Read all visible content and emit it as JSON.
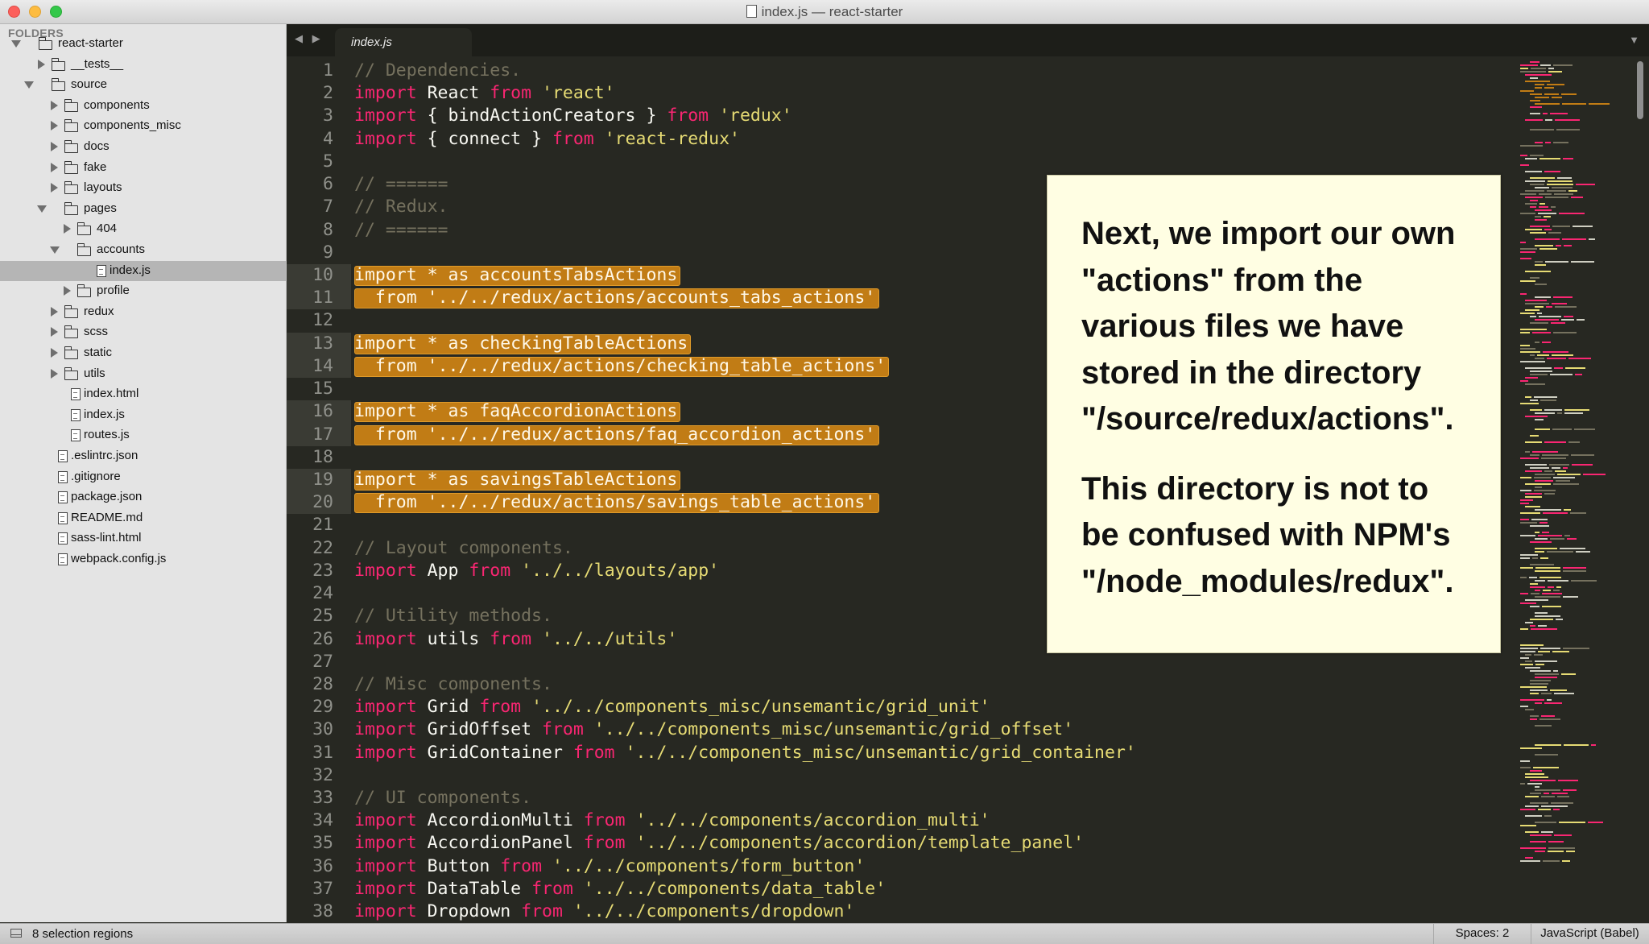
{
  "window": {
    "title": "index.js — react-starter"
  },
  "sidebar": {
    "header": "FOLDERS",
    "tree": [
      {
        "label": "react-starter",
        "type": "folder",
        "depth": 0,
        "open": true
      },
      {
        "label": "__tests__",
        "type": "folder",
        "depth": 1,
        "open": false
      },
      {
        "label": "source",
        "type": "folder",
        "depth": 1,
        "open": true
      },
      {
        "label": "components",
        "type": "folder",
        "depth": 2,
        "open": false
      },
      {
        "label": "components_misc",
        "type": "folder",
        "depth": 2,
        "open": false
      },
      {
        "label": "docs",
        "type": "folder",
        "depth": 2,
        "open": false
      },
      {
        "label": "fake",
        "type": "folder",
        "depth": 2,
        "open": false
      },
      {
        "label": "layouts",
        "type": "folder",
        "depth": 2,
        "open": false
      },
      {
        "label": "pages",
        "type": "folder",
        "depth": 2,
        "open": true
      },
      {
        "label": "404",
        "type": "folder",
        "depth": 3,
        "open": false
      },
      {
        "label": "accounts",
        "type": "folder",
        "depth": 3,
        "open": true
      },
      {
        "label": "index.js",
        "type": "file",
        "depth": 4,
        "selected": true
      },
      {
        "label": "profile",
        "type": "folder",
        "depth": 3,
        "open": false
      },
      {
        "label": "redux",
        "type": "folder",
        "depth": 2,
        "open": false
      },
      {
        "label": "scss",
        "type": "folder",
        "depth": 2,
        "open": false
      },
      {
        "label": "static",
        "type": "folder",
        "depth": 2,
        "open": false
      },
      {
        "label": "utils",
        "type": "folder",
        "depth": 2,
        "open": false
      },
      {
        "label": "index.html",
        "type": "file",
        "depth": 2
      },
      {
        "label": "index.js",
        "type": "file",
        "depth": 2
      },
      {
        "label": "routes.js",
        "type": "file",
        "depth": 2
      },
      {
        "label": ".eslintrc.json",
        "type": "file",
        "depth": 1
      },
      {
        "label": ".gitignore",
        "type": "file",
        "depth": 1
      },
      {
        "label": "package.json",
        "type": "file",
        "depth": 1
      },
      {
        "label": "README.md",
        "type": "file",
        "depth": 1
      },
      {
        "label": "sass-lint.html",
        "type": "file",
        "depth": 1
      },
      {
        "label": "webpack.config.js",
        "type": "file",
        "depth": 1
      }
    ]
  },
  "tabs": {
    "nav": "◀ ▶",
    "active": "index.js",
    "menu_icon": "▼"
  },
  "editor": {
    "lines": [
      {
        "n": 1,
        "tokens": [
          [
            "cm",
            "// Dependencies."
          ]
        ]
      },
      {
        "n": 2,
        "tokens": [
          [
            "kw",
            "import"
          ],
          [
            "",
            " React "
          ],
          [
            "kw",
            "from"
          ],
          [
            "",
            " "
          ],
          [
            "st",
            "'react'"
          ]
        ]
      },
      {
        "n": 3,
        "tokens": [
          [
            "kw",
            "import"
          ],
          [
            "",
            " { bindActionCreators } "
          ],
          [
            "kw",
            "from"
          ],
          [
            "",
            " "
          ],
          [
            "st",
            "'redux'"
          ]
        ]
      },
      {
        "n": 4,
        "tokens": [
          [
            "kw",
            "import"
          ],
          [
            "",
            " { connect } "
          ],
          [
            "kw",
            "from"
          ],
          [
            "",
            " "
          ],
          [
            "st",
            "'react-redux'"
          ]
        ]
      },
      {
        "n": 5,
        "tokens": []
      },
      {
        "n": 6,
        "tokens": [
          [
            "cm",
            "// ======"
          ]
        ]
      },
      {
        "n": 7,
        "tokens": [
          [
            "cm",
            "// Redux."
          ]
        ]
      },
      {
        "n": 8,
        "tokens": [
          [
            "cm",
            "// ======"
          ]
        ]
      },
      {
        "n": 9,
        "tokens": []
      },
      {
        "n": 10,
        "sel": true,
        "tokens": [
          [
            "kw",
            "import"
          ],
          [
            "",
            " * as accountsTabsActions"
          ]
        ]
      },
      {
        "n": 11,
        "sel": true,
        "tokens": [
          [
            "",
            "  "
          ],
          [
            "kw",
            "from"
          ],
          [
            "",
            " "
          ],
          [
            "st",
            "'../../redux/actions/accounts_tabs_actions'"
          ]
        ]
      },
      {
        "n": 12,
        "tokens": []
      },
      {
        "n": 13,
        "sel": true,
        "tokens": [
          [
            "kw",
            "import"
          ],
          [
            "",
            " * as checkingTableActions"
          ]
        ]
      },
      {
        "n": 14,
        "sel": true,
        "tokens": [
          [
            "",
            "  "
          ],
          [
            "kw",
            "from"
          ],
          [
            "",
            " "
          ],
          [
            "st",
            "'../../redux/actions/checking_table_actions'"
          ]
        ]
      },
      {
        "n": 15,
        "tokens": []
      },
      {
        "n": 16,
        "sel": true,
        "tokens": [
          [
            "kw",
            "import"
          ],
          [
            "",
            " * as faqAccordionActions"
          ]
        ]
      },
      {
        "n": 17,
        "sel": true,
        "tokens": [
          [
            "",
            "  "
          ],
          [
            "kw",
            "from"
          ],
          [
            "",
            " "
          ],
          [
            "st",
            "'../../redux/actions/faq_accordion_actions'"
          ]
        ]
      },
      {
        "n": 18,
        "tokens": []
      },
      {
        "n": 19,
        "sel": true,
        "tokens": [
          [
            "kw",
            "import"
          ],
          [
            "",
            " * as savingsTableActions"
          ]
        ]
      },
      {
        "n": 20,
        "sel": true,
        "tokens": [
          [
            "",
            "  "
          ],
          [
            "kw",
            "from"
          ],
          [
            "",
            " "
          ],
          [
            "st",
            "'../../redux/actions/savings_table_actions'"
          ]
        ]
      },
      {
        "n": 21,
        "tokens": []
      },
      {
        "n": 22,
        "tokens": [
          [
            "cm",
            "// Layout components."
          ]
        ]
      },
      {
        "n": 23,
        "tokens": [
          [
            "kw",
            "import"
          ],
          [
            "",
            " App "
          ],
          [
            "kw",
            "from"
          ],
          [
            "",
            " "
          ],
          [
            "st",
            "'../../layouts/app'"
          ]
        ]
      },
      {
        "n": 24,
        "tokens": []
      },
      {
        "n": 25,
        "tokens": [
          [
            "cm",
            "// Utility methods."
          ]
        ]
      },
      {
        "n": 26,
        "tokens": [
          [
            "kw",
            "import"
          ],
          [
            "",
            " utils "
          ],
          [
            "kw",
            "from"
          ],
          [
            "",
            " "
          ],
          [
            "st",
            "'../../utils'"
          ]
        ]
      },
      {
        "n": 27,
        "tokens": []
      },
      {
        "n": 28,
        "tokens": [
          [
            "cm",
            "// Misc components."
          ]
        ]
      },
      {
        "n": 29,
        "tokens": [
          [
            "kw",
            "import"
          ],
          [
            "",
            " Grid "
          ],
          [
            "kw",
            "from"
          ],
          [
            "",
            " "
          ],
          [
            "st",
            "'../../components_misc/unsemantic/grid_unit'"
          ]
        ]
      },
      {
        "n": 30,
        "tokens": [
          [
            "kw",
            "import"
          ],
          [
            "",
            " GridOffset "
          ],
          [
            "kw",
            "from"
          ],
          [
            "",
            " "
          ],
          [
            "st",
            "'../../components_misc/unsemantic/grid_offset'"
          ]
        ]
      },
      {
        "n": 31,
        "tokens": [
          [
            "kw",
            "import"
          ],
          [
            "",
            " GridContainer "
          ],
          [
            "kw",
            "from"
          ],
          [
            "",
            " "
          ],
          [
            "st",
            "'../../components_misc/unsemantic/grid_container'"
          ]
        ]
      },
      {
        "n": 32,
        "tokens": []
      },
      {
        "n": 33,
        "tokens": [
          [
            "cm",
            "// UI components."
          ]
        ]
      },
      {
        "n": 34,
        "tokens": [
          [
            "kw",
            "import"
          ],
          [
            "",
            " AccordionMulti "
          ],
          [
            "kw",
            "from"
          ],
          [
            "",
            " "
          ],
          [
            "st",
            "'../../components/accordion_multi'"
          ]
        ]
      },
      {
        "n": 35,
        "tokens": [
          [
            "kw",
            "import"
          ],
          [
            "",
            " AccordionPanel "
          ],
          [
            "kw",
            "from"
          ],
          [
            "",
            " "
          ],
          [
            "st",
            "'../../components/accordion/template_panel'"
          ]
        ]
      },
      {
        "n": 36,
        "tokens": [
          [
            "kw",
            "import"
          ],
          [
            "",
            " Button "
          ],
          [
            "kw",
            "from"
          ],
          [
            "",
            " "
          ],
          [
            "st",
            "'../../components/form_button'"
          ]
        ]
      },
      {
        "n": 37,
        "tokens": [
          [
            "kw",
            "import"
          ],
          [
            "",
            " DataTable "
          ],
          [
            "kw",
            "from"
          ],
          [
            "",
            " "
          ],
          [
            "st",
            "'../../components/data_table'"
          ]
        ]
      },
      {
        "n": 38,
        "tokens": [
          [
            "kw",
            "import"
          ],
          [
            "",
            " Dropdown "
          ],
          [
            "kw",
            "from"
          ],
          [
            "",
            " "
          ],
          [
            "st",
            "'../../components/dropdown'"
          ]
        ]
      }
    ]
  },
  "annotation": {
    "para1": "Next, we import our own\n\"actions\" from the\nvarious files we have\nstored in the directory\n\"/source/redux/actions\".",
    "para2": "This directory is not to\nbe confused with NPM's\n\"/node_modules/redux\"."
  },
  "statusbar": {
    "selection": "8 selection regions",
    "spaces": "Spaces: 2",
    "syntax": "JavaScript (Babel)"
  },
  "colors": {
    "background": "#272822",
    "keyword": "#f92672",
    "string": "#e6db74",
    "comment": "#75715e",
    "selection": "#c17c15"
  }
}
